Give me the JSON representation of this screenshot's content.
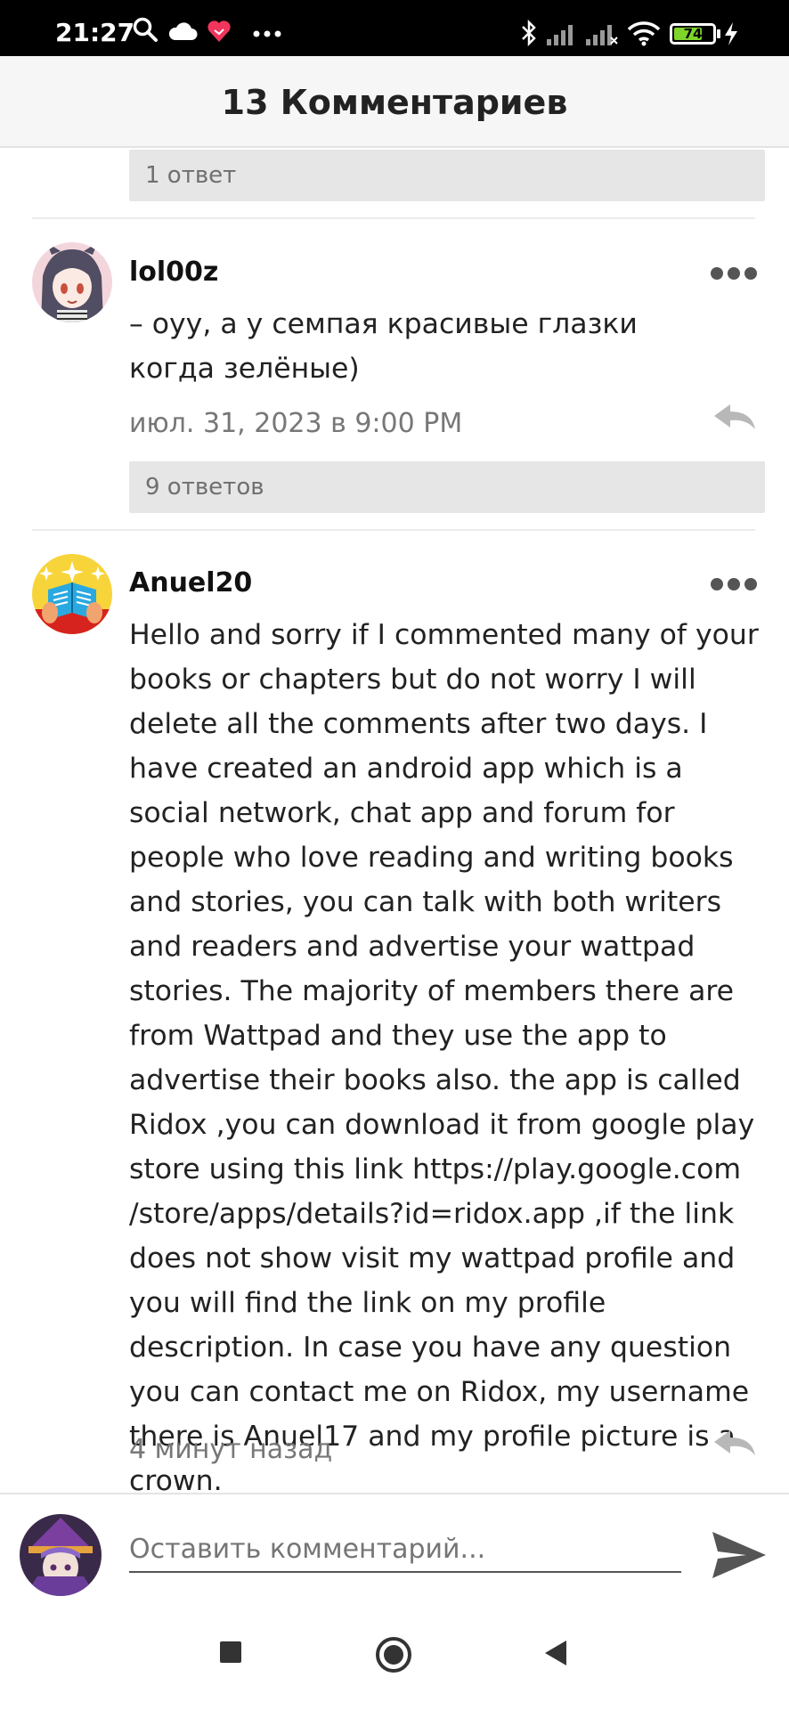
{
  "status_bar": {
    "time": "21:27",
    "battery": "74",
    "battery_level": 0.74,
    "icons": [
      "search-icon",
      "cloud-icon",
      "heart-icon",
      "more-dots-icon",
      "bluetooth-icon",
      "signal-icon",
      "signal-icon",
      "wifi-icon",
      "battery-icon",
      "charging-icon"
    ]
  },
  "header": {
    "title": "13 Комментариев"
  },
  "comments": [
    {
      "replies_label": "1 ответ"
    },
    {
      "username": "lol00z",
      "text": "– оуу, а у семпая красивые глазки когда зелёные)",
      "timestamp": "июл. 31, 2023 в 9:00 PM",
      "replies_label": "9 ответов"
    },
    {
      "username": "Anuel20",
      "text": "Hello and sorry if I commented many of your books or chapters but do not worry I will delete all the comments after two days. I have created an android app which is a social network, chat app and forum for people who love reading and writing books and stories, you can talk with both writers and readers and advertise your wattpad stories. The majority of members there are from Wattpad and they use the app to advertise their books also. the app is called Ridox ,you can download it from google play store using this link https://play.google.com /store/apps/details?id=ridox.app ,if the link does not show visit my wattpad profile and you will find the link on my profile description. In case you have any question you can contact me on Ridox, my username there is Anuel17 and my profile picture is a crown.",
      "timestamp": "4 минут назад"
    }
  ],
  "composer": {
    "placeholder": "Оставить комментарий..."
  },
  "colors": {
    "header_bg": "#f6f6f6",
    "replies_bg": "#e6e6e6",
    "battery_green": "#7fd42a"
  }
}
